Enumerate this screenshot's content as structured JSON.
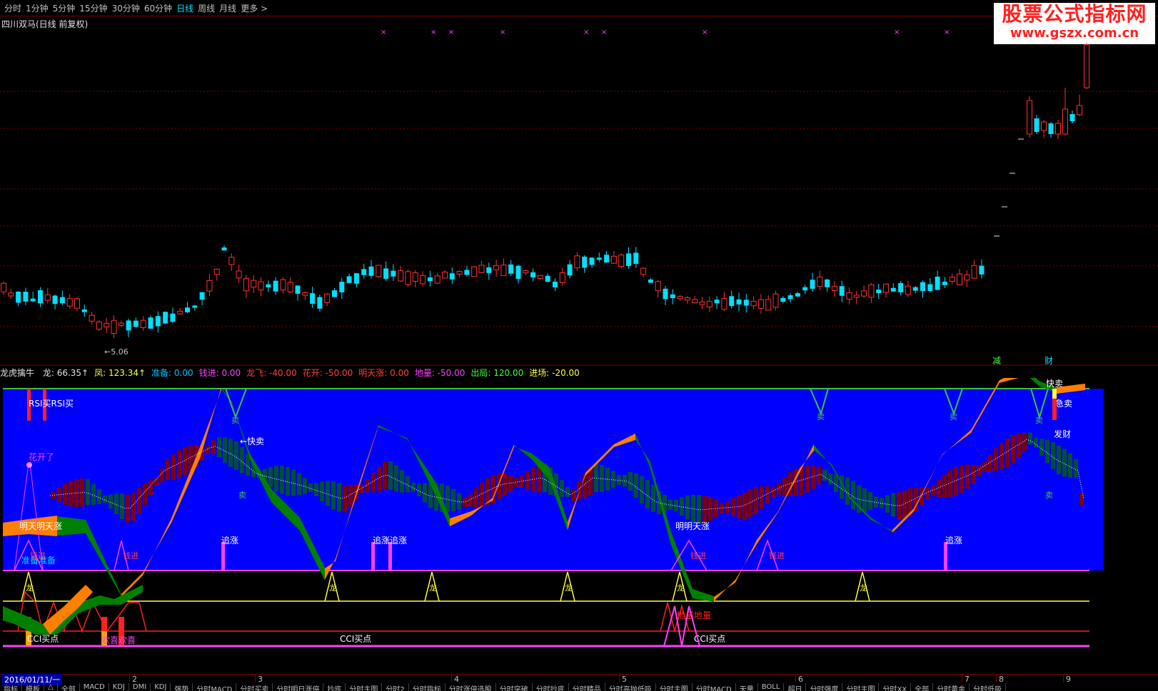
{
  "toolbar": {
    "periods": [
      "分时",
      "1分钟",
      "5分钟",
      "15分钟",
      "30分钟",
      "60分钟",
      "日线",
      "周线",
      "月线",
      "更多 >"
    ],
    "active": "日线"
  },
  "stock_title": "四川双马(日线 前复权)",
  "watermark": {
    "line1": "股票公式指标网",
    "line2": "www.gszx.com.cn"
  },
  "price_panel": {
    "low_label": "←5.06",
    "tags": [
      "减",
      "财"
    ]
  },
  "indicator": {
    "name": "龙虎擒牛",
    "values": [
      {
        "label": "龙:",
        "value": "66.35↑",
        "color": "#e0e0e0"
      },
      {
        "label": "凤:",
        "value": "123.34↑",
        "color": "#ffff40"
      },
      {
        "label": "准备:",
        "value": "0.00",
        "color": "#00c0ff"
      },
      {
        "label": "钱进:",
        "value": "0.00",
        "color": "#ff40ff"
      },
      {
        "label": "龙飞:",
        "value": "-40.00",
        "color": "#ff4040"
      },
      {
        "label": "花开:",
        "value": "-50.00",
        "color": "#ff4040"
      },
      {
        "label": "明天涨:",
        "value": "0.00",
        "color": "#ff4040"
      },
      {
        "label": "地量:",
        "value": "-50.00",
        "color": "#ff40ff"
      },
      {
        "label": "出局:",
        "value": "120.00",
        "color": "#40ff40"
      },
      {
        "label": "进场:",
        "value": "-20.00",
        "color": "#ffff40"
      }
    ],
    "annotations": {
      "rsi_buy": "RSI买RSI买",
      "flower": "花开了",
      "fast_sell": "←快卖",
      "fast_sell2": "快卖",
      "urgent_sell": "急卖",
      "fortune": "发财",
      "tomorrow_up": "明天明天涨",
      "tomorrow_up2": "明明天涨",
      "chase": "追涨",
      "chase2": "追涨追涨",
      "ready": "准备准备",
      "enter": "钱进",
      "dragon": "龙",
      "sell": "卖",
      "low_volume": "地量地量",
      "cci_buy": "CCI买点",
      "cci_buy2": "CCI买点",
      "joy": "欢喜欢喜"
    }
  },
  "date_axis": {
    "start": "2016/01/11/一",
    "months": [
      "2",
      "3",
      "4",
      "5",
      "6",
      "7",
      "8",
      "9"
    ]
  },
  "bottom_tabs": [
    "指标",
    "模板",
    "△",
    "全部",
    "MACD",
    "KDJ",
    "DMI",
    "KDJ",
    "强势",
    "分时MACD",
    "分时买卖",
    "分时明日涨停",
    "抄底",
    "分时主图",
    "分时2",
    "分时指标",
    "分时涨停选股",
    "分时突破",
    "分时抄底",
    "分时精品",
    "分时高抛低吸",
    "分时主图",
    "分时MACD",
    "天量",
    "BOLL",
    "超日",
    "分时强度",
    "分时主图",
    "分时XX",
    "全部",
    "分时黄金",
    "分时低吸"
  ],
  "colors": {
    "up": "#ff3030",
    "down": "#00e0ff",
    "panel_blue": "#0000ff",
    "orange": "#ff7f00",
    "green": "#008000",
    "grid": "#800000"
  }
}
